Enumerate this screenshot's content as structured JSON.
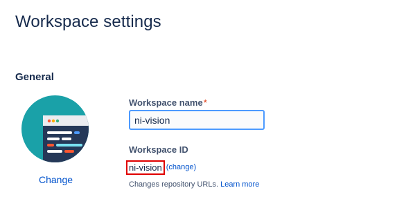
{
  "page": {
    "title": "Workspace settings"
  },
  "general": {
    "section_title": "General",
    "avatar": {
      "icon": "workspace-code-window-icon",
      "change_label": "Change"
    },
    "workspace_name": {
      "label": "Workspace name",
      "required_mark": "*",
      "value": "ni-vision"
    },
    "workspace_id": {
      "label": "Workspace ID",
      "value": "ni-vision",
      "change_open": "(",
      "change_label": "change",
      "change_close": ")",
      "help_text": "Changes repository URLs.",
      "learn_more_label": "Learn more"
    }
  },
  "colors": {
    "avatar_bg": "#1aa1a8",
    "link": "#0052cc",
    "highlight_box": "#e00000",
    "input_focus_border": "#4c9aff"
  }
}
